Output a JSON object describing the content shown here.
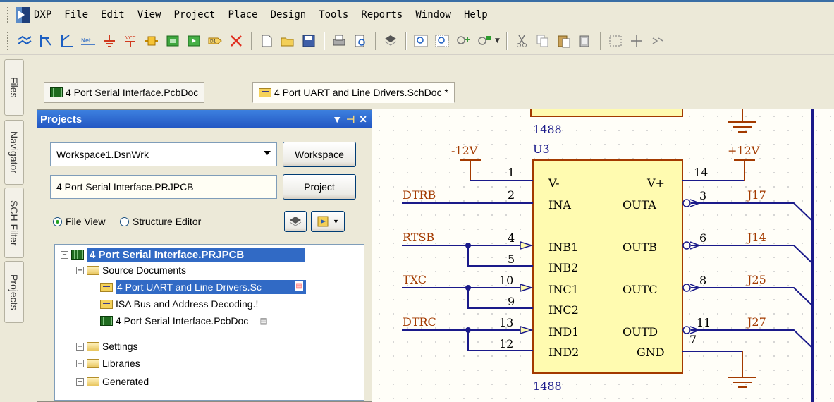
{
  "menubar": {
    "items": [
      "DXP",
      "File",
      "Edit",
      "View",
      "Project",
      "Place",
      "Design",
      "Tools",
      "Reports",
      "Window",
      "Help"
    ]
  },
  "side_tabs": [
    "Files",
    "Navigator",
    "SCH Filter",
    "Projects"
  ],
  "doc_tabs": [
    "4 Port Serial Interface.PcbDoc",
    "4 Port UART and Line Drivers.SchDoc *"
  ],
  "projects": {
    "title": "Projects",
    "workspace_value": "Workspace1.DsnWrk",
    "workspace_button": "Workspace",
    "project_value": "4 Port Serial Interface.PRJPCB",
    "project_button": "Project",
    "radio_file_view": "File View",
    "radio_structure": "Structure Editor",
    "tree": [
      "4 Port Serial Interface.PRJPCB",
      "Source Documents",
      "4 Port UART and Line Drivers.Sc",
      "ISA Bus and Address Decoding.!",
      "4 Port Serial Interface.PcbDoc",
      "Settings",
      "Libraries",
      "Generated"
    ]
  },
  "schematic": {
    "top_label": "1488",
    "bottom_label": "1488",
    "designator": "U3",
    "neg_supply": "-12V",
    "pos_supply": "+12V",
    "left_pins": [
      {
        "num": "1",
        "name": "V-"
      },
      {
        "num": "2",
        "name": "INA"
      },
      {
        "num": "4",
        "name": "INB1"
      },
      {
        "num": "5",
        "name": "INB2"
      },
      {
        "num": "10",
        "name": "INC1"
      },
      {
        "num": "9",
        "name": "INC2"
      },
      {
        "num": "13",
        "name": "IND1"
      },
      {
        "num": "12",
        "name": "IND2"
      }
    ],
    "right_pins": [
      {
        "num": "14",
        "name": "V+"
      },
      {
        "num": "3",
        "name": "OUTA"
      },
      {
        "num": "6",
        "name": "OUTB"
      },
      {
        "num": "8",
        "name": "OUTC"
      },
      {
        "num": "11",
        "name": "OUTD"
      },
      {
        "num": "7",
        "name": "GND"
      }
    ],
    "net_labels_left": [
      "DTRB",
      "RTSB",
      "TXC",
      "DTRC"
    ],
    "net_labels_right": [
      "J17",
      "J14",
      "J25",
      "J27"
    ]
  }
}
